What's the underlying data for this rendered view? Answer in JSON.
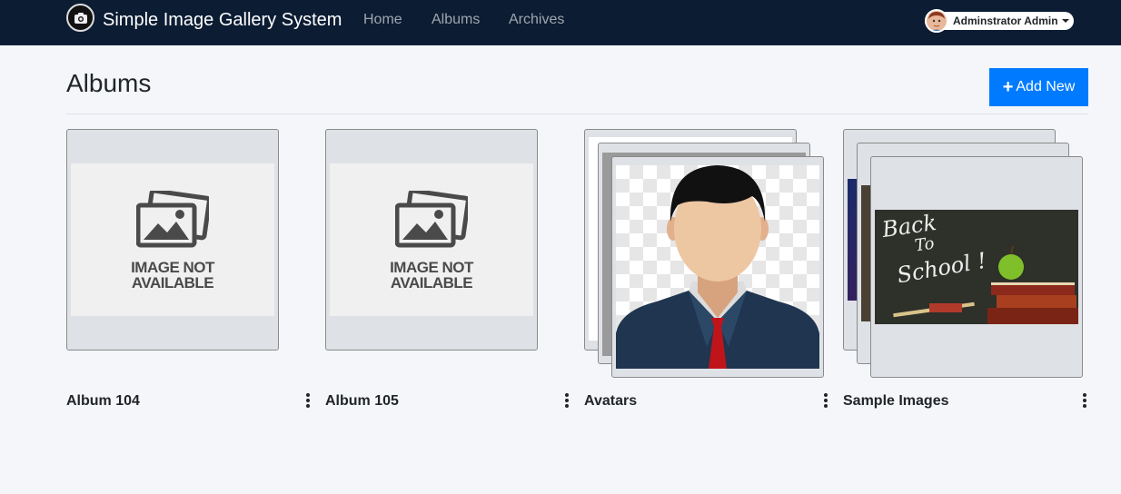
{
  "navbar": {
    "title": "Simple Image Gallery System",
    "links": [
      "Home",
      "Albums",
      "Archives"
    ],
    "user": "Adminstrator Admin",
    "logo_icon": "camera-icon",
    "bg_color": "#0b1c33"
  },
  "page": {
    "title": "Albums",
    "add_label": "Add New",
    "add_icon": "plus-icon",
    "accent": "#007bff"
  },
  "albums": [
    {
      "name": "Album 104",
      "image": "image-not-available",
      "placeholder_line1": "IMAGE NOT",
      "placeholder_line2": "AVAILABLE"
    },
    {
      "name": "Album 105",
      "image": "image-not-available",
      "placeholder_line1": "IMAGE NOT",
      "placeholder_line2": "AVAILABLE"
    },
    {
      "name": "Avatars",
      "image": "avatar-illustration"
    },
    {
      "name": "Sample Images",
      "image": "back-to-school-chalkboard",
      "chalk_line1": "Back",
      "chalk_line2": "To",
      "chalk_line3": "School !"
    }
  ]
}
